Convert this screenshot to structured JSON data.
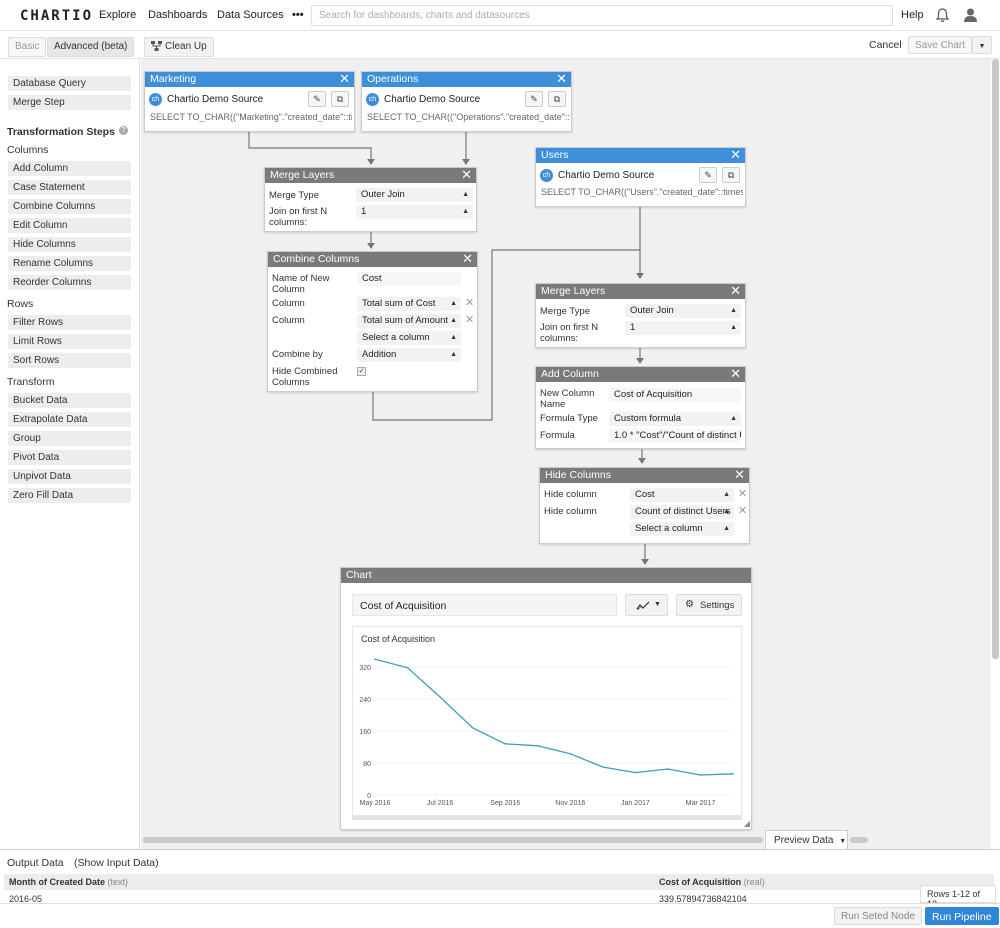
{
  "nav": {
    "logo": "CHARTIO",
    "explore": "Explore",
    "dashboards": "Dashboards",
    "datasources": "Data Sources",
    "more": "•••",
    "search_placeholder": "Search for dashboards, charts and datasources",
    "help": "Help"
  },
  "toolbar": {
    "basic": "Basic",
    "advanced": "Advanced (beta)",
    "cleanup": "Clean Up",
    "cancel": "Cancel",
    "save": "Save Chart"
  },
  "sidebar": {
    "query": "Database Query",
    "merge": "Merge Step",
    "transformation": "Transformation Steps",
    "columns_header": "Columns",
    "columns": [
      "Add Column",
      "Case Statement",
      "Combine Columns",
      "Edit Column",
      "Hide Columns",
      "Rename Columns",
      "Reorder Columns"
    ],
    "rows_header": "Rows",
    "rows": [
      "Filter Rows",
      "Limit Rows",
      "Sort Rows"
    ],
    "transform_header": "Transform",
    "transform": [
      "Bucket Data",
      "Extrapolate Data",
      "Group",
      "Pivot Data",
      "Unpivot Data",
      "Zero Fill Data"
    ]
  },
  "nodes": {
    "marketing": {
      "title": "Marketing",
      "source": "Chartio Demo Source",
      "sql": "SELECT TO_CHAR((\"Marketing\".\"created_date\"::tim..."
    },
    "operations": {
      "title": "Operations",
      "source": "Chartio Demo Source",
      "sql": "SELECT TO_CHAR((\"Operations\".\"created_date\"::ti..."
    },
    "users": {
      "title": "Users",
      "source": "Chartio Demo Source",
      "sql": "SELECT TO_CHAR((\"Users\".\"created_date\"::timest..."
    },
    "merge1": {
      "title": "Merge Layers",
      "type_label": "Merge Type",
      "type": "Outer Join",
      "join_label": "Join on first N columns:",
      "join": "1"
    },
    "combine": {
      "title": "Combine Columns",
      "name_label": "Name of New Column",
      "name": "Cost",
      "col_label": "Column",
      "col1": "Total sum of Cost",
      "col2": "Total sum of Amount",
      "col3": "Select a column",
      "by_label": "Combine by",
      "by": "Addition",
      "hide_label": "Hide Combined Columns"
    },
    "merge2": {
      "title": "Merge Layers",
      "type_label": "Merge Type",
      "type": "Outer Join",
      "join_label": "Join on first N columns:",
      "join": "1"
    },
    "addcol": {
      "title": "Add Column",
      "name_label": "New Column Name",
      "name": "Cost of Acquisition",
      "ftype_label": "Formula Type",
      "ftype": "Custom formula",
      "formula_label": "Formula",
      "formula": "1.0 * \"Cost\"/\"Count of distinct U"
    },
    "hidecol": {
      "title": "Hide Columns",
      "label": "Hide column",
      "c1": "Cost",
      "c2": "Count of distinct Users",
      "c3": "Select a column"
    },
    "chart": {
      "title": "Chart",
      "name": "Cost of Acquisition",
      "settings": "Settings"
    }
  },
  "chart_data": {
    "type": "line",
    "title": "Cost of Acquisition",
    "x": [
      "2016-05",
      "2016-06",
      "2016-07",
      "2016-08",
      "2016-09",
      "2016-10",
      "2016-11",
      "2016-12",
      "2017-01",
      "2017-02",
      "2017-03",
      "2017-04"
    ],
    "xticks": [
      "May 2016",
      "Jul 2016",
      "Sep 2016",
      "Nov 2016",
      "Jan 2017",
      "Mar 2017"
    ],
    "values": [
      339.6,
      318,
      245,
      168,
      128,
      123,
      103,
      70,
      56,
      65,
      50,
      53
    ],
    "yticks": [
      0,
      80,
      160,
      240,
      320
    ],
    "ylim": [
      0,
      345
    ],
    "color": "#3d9dbe"
  },
  "bottom": {
    "preview": "Preview Data",
    "output": "Output Data",
    "show_input": "(Show Input Data)",
    "col1": "Month of Created Date",
    "col1_type": "(text)",
    "col2": "Cost of Acquisition",
    "col2_type": "(real)",
    "row1_c1": "2016-05",
    "row1_c2": "339.57894736842104",
    "rows_count": "Rows 1-12 of 12",
    "run_selected": "Run Seted Node",
    "run_pipeline": "Run Pipeline"
  }
}
